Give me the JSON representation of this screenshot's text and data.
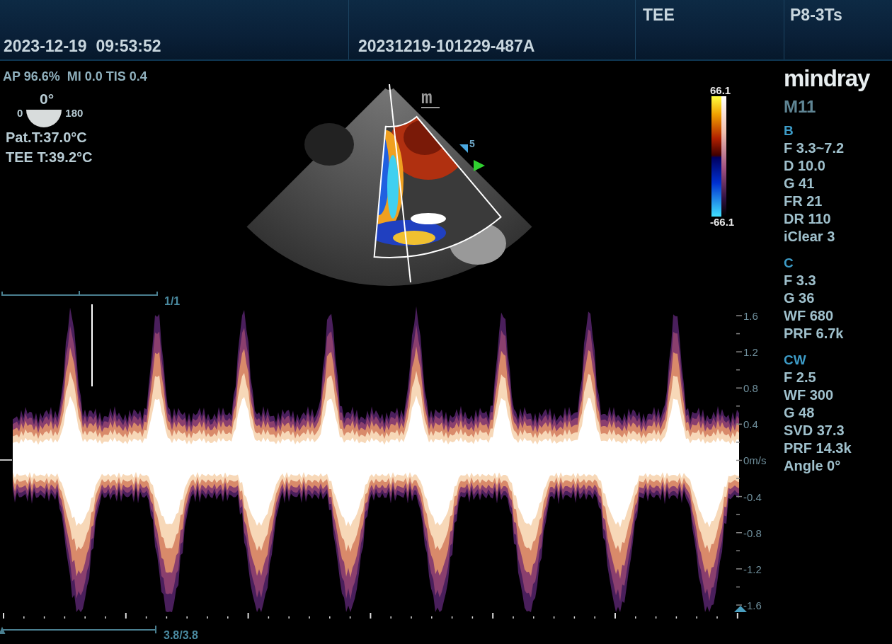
{
  "top_bar": {
    "datetime": "2023-12-19  09:53:52",
    "exam_id": "20231219-101229-487A",
    "exam_type": "TEE",
    "probe": "P8-3Ts"
  },
  "left_info": {
    "acoustic": "AP 96.6%  MI 0.0 TIS 0.4",
    "probe_angle": {
      "value": "0°",
      "min": "0",
      "max": "180"
    },
    "patient_temp": "Pat.T:37.0°C",
    "probe_temp": "TEE T:39.2°C"
  },
  "sector": {
    "orientation_mark": "m",
    "depth_marker": "5"
  },
  "color_scale": {
    "max": "66.1",
    "min": "-66.1"
  },
  "doppler": {
    "cine_top": "1/1",
    "cine_bottom": "3.8/3.8",
    "scale_labels": [
      "1.6",
      "1.2",
      "0.8",
      "0.4",
      "0m/s",
      "-0.4",
      "-0.8",
      "-1.2",
      "-1.6"
    ]
  },
  "right_panel": {
    "logo": "mindray",
    "model": "M11",
    "sections": [
      {
        "title": "B",
        "params": [
          "F 3.3~7.2",
          "D 10.0",
          "G 41",
          "FR 21",
          "DR 110",
          "iClear 3"
        ]
      },
      {
        "title": "C",
        "params": [
          "F 3.3",
          "G 36",
          "WF 680",
          "PRF 6.7k"
        ]
      },
      {
        "title": "CW",
        "params": [
          "F 2.5",
          "WF 300",
          "G 48",
          "SVD 37.3",
          "PRF 14.3k",
          "Angle 0°"
        ]
      }
    ]
  }
}
